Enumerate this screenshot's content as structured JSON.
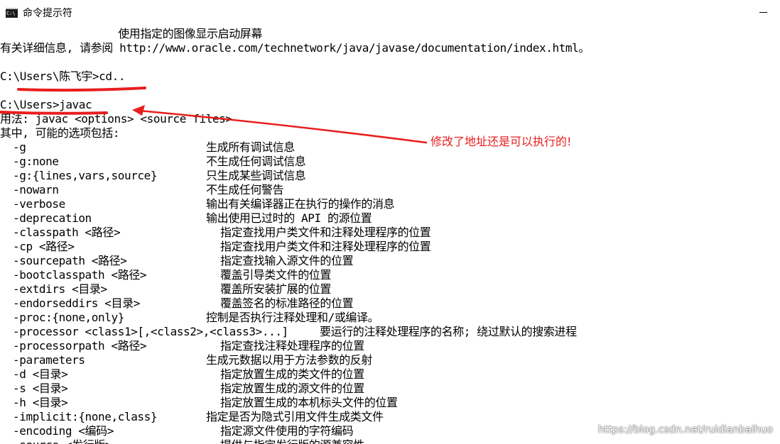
{
  "window": {
    "title": "命令提示符",
    "icon": "cmd-icon"
  },
  "console": {
    "lines": [
      {
        "text": "                  使用指定的图像显示启动屏幕"
      },
      {
        "text": "有关详细信息, 请参阅 http://www.oracle.com/technetwork/java/javase/documentation/index.html。"
      },
      {
        "text": ""
      },
      {
        "text": "C:\\Users\\陈飞宇>cd.."
      },
      {
        "text": ""
      },
      {
        "text": "C:\\Users>javac"
      },
      {
        "text": "用法: javac <options> <source files>"
      },
      {
        "text": "其中, 可能的选项包括:"
      }
    ],
    "options": [
      {
        "opt": "-g",
        "desc": "生成所有调试信息",
        "col": "d1"
      },
      {
        "opt": "-g:none",
        "desc": "不生成任何调试信息",
        "col": "d1"
      },
      {
        "opt": "-g:{lines,vars,source}",
        "desc": "只生成某些调试信息",
        "col": "d1"
      },
      {
        "opt": "-nowarn",
        "desc": "不生成任何警告",
        "col": "d1"
      },
      {
        "opt": "-verbose",
        "desc": "输出有关编译器正在执行的操作的消息",
        "col": "d1"
      },
      {
        "opt": "-deprecation",
        "desc": "输出使用已过时的 API 的源位置",
        "col": "d1"
      },
      {
        "opt": "-classpath <路径>",
        "desc": "指定查找用户类文件和注释处理程序的位置",
        "col": "d2"
      },
      {
        "opt": "-cp <路径>",
        "desc": "指定查找用户类文件和注释处理程序的位置",
        "col": "d2"
      },
      {
        "opt": "-sourcepath <路径>",
        "desc": "指定查找输入源文件的位置",
        "col": "d2"
      },
      {
        "opt": "-bootclasspath <路径>",
        "desc": "覆盖引导类文件的位置",
        "col": "d2"
      },
      {
        "opt": "-extdirs <目录>",
        "desc": "覆盖所安装扩展的位置",
        "col": "d2"
      },
      {
        "opt": "-endorseddirs <目录>",
        "desc": "覆盖签名的标准路径的位置",
        "col": "d2"
      },
      {
        "opt": "-proc:{none,only}",
        "desc": "控制是否执行注释处理和/或编译。",
        "col": "d1"
      },
      {
        "opt": "-processor <class1>[,<class2>,<class3>...]",
        "desc": "要运行的注释处理程序的名称; 绕过默认的搜索进程",
        "col": "d3"
      },
      {
        "opt": "-processorpath <路径>",
        "desc": "指定查找注释处理程序的位置",
        "col": "d2"
      },
      {
        "opt": "-parameters",
        "desc": "生成元数据以用于方法参数的反射",
        "col": "d1"
      },
      {
        "opt": "-d <目录>",
        "desc": "指定放置生成的类文件的位置",
        "col": "d2"
      },
      {
        "opt": "-s <目录>",
        "desc": "指定放置生成的源文件的位置",
        "col": "d2"
      },
      {
        "opt": "-h <目录>",
        "desc": "指定放置生成的本机标头文件的位置",
        "col": "d2"
      },
      {
        "opt": "-implicit:{none,class}",
        "desc": "指定是否为隐式引用文件生成类文件",
        "col": "d1"
      },
      {
        "opt": "-encoding <编码>",
        "desc": "指定源文件使用的字符编码",
        "col": "d2"
      },
      {
        "opt": "-source <发行版>",
        "desc": "提供与指定发行版的源兼容性",
        "col": "d2"
      }
    ]
  },
  "annotation": {
    "note": "修改了地址还是可以执行的!",
    "color": "#e81e1e"
  },
  "watermark": "https://blog.csdn.net/ruidianbaihuo"
}
